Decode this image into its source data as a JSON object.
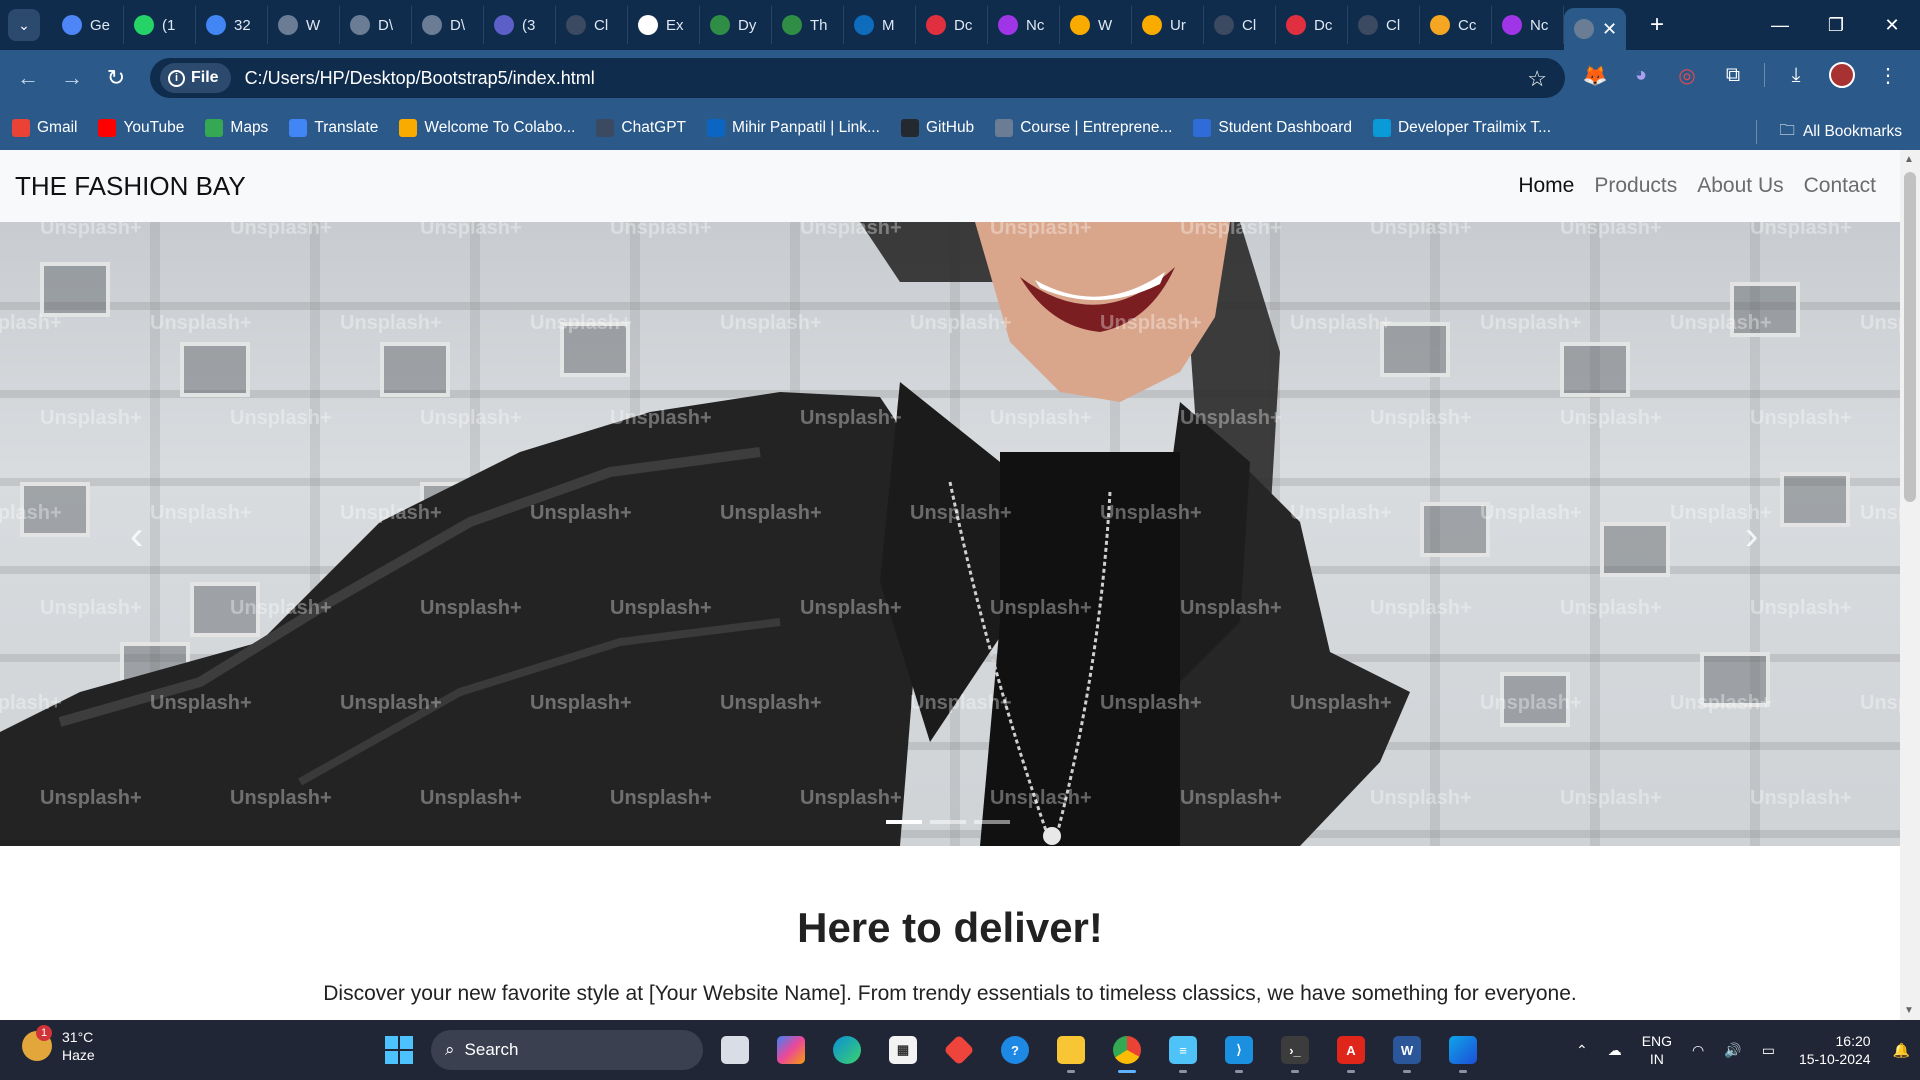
{
  "browser": {
    "tabs": [
      {
        "label": "Ge",
        "icon": "gemini-icon",
        "color": "#4e86f7"
      },
      {
        "label": "(1",
        "icon": "whatsapp-icon",
        "color": "#25d366"
      },
      {
        "label": "32",
        "icon": "docs-icon",
        "color": "#4285f4"
      },
      {
        "label": "W",
        "icon": "globe-icon",
        "color": "#6b7d95"
      },
      {
        "label": "D\\",
        "icon": "globe-icon",
        "color": "#6b7d95"
      },
      {
        "label": "D\\",
        "icon": "globe-icon",
        "color": "#6b7d95"
      },
      {
        "label": "(3",
        "icon": "teams-icon",
        "color": "#5b5fc7"
      },
      {
        "label": "Cl",
        "icon": "chatgpt-icon",
        "color": "#3b4a60"
      },
      {
        "label": "Ex",
        "icon": "google-icon",
        "color": "#ffffff"
      },
      {
        "label": "Dy",
        "icon": "geeks-icon",
        "color": "#2f8d46"
      },
      {
        "label": "Th",
        "icon": "geeks-icon",
        "color": "#2f8d46"
      },
      {
        "label": "M",
        "icon": "outlook-icon",
        "color": "#0f6cbd"
      },
      {
        "label": "Dc",
        "icon": "heart-icon",
        "color": "#e03040"
      },
      {
        "label": "Nc",
        "icon": "messenger-icon",
        "color": "#a035e8"
      },
      {
        "label": "W",
        "icon": "colab-icon",
        "color": "#f9ab00"
      },
      {
        "label": "Ur",
        "icon": "colab-icon",
        "color": "#f9ab00"
      },
      {
        "label": "Cl",
        "icon": "chatgpt-icon",
        "color": "#3b4a60"
      },
      {
        "label": "Dc",
        "icon": "heart-icon",
        "color": "#e03040"
      },
      {
        "label": "Cl",
        "icon": "chatgpt-icon",
        "color": "#3b4a60"
      },
      {
        "label": "Cc",
        "icon": "coursera-icon",
        "color": "#f5a623"
      },
      {
        "label": "Nc",
        "icon": "messenger-icon",
        "color": "#a035e8"
      }
    ],
    "active_tab_icon": "globe-icon",
    "url_chip": "File",
    "url": "C:/Users/HP/Desktop/Bootstrap5/index.html",
    "bookmarks": [
      {
        "label": "Gmail",
        "color": "#ea4335"
      },
      {
        "label": "YouTube",
        "color": "#ff0000"
      },
      {
        "label": "Maps",
        "color": "#34a853"
      },
      {
        "label": "Translate",
        "color": "#4285f4"
      },
      {
        "label": "Welcome To Colabo...",
        "color": "#f9ab00"
      },
      {
        "label": "ChatGPT",
        "color": "#3b4a60"
      },
      {
        "label": "Mihir Panpatil | Link...",
        "color": "#0a66c2"
      },
      {
        "label": "GitHub",
        "color": "#24292f"
      },
      {
        "label": "Course | Entreprene...",
        "color": "#6b7d95"
      },
      {
        "label": "Student Dashboard",
        "color": "#2f6cd8"
      },
      {
        "label": "Developer Trailmix T...",
        "color": "#0b9ad8"
      }
    ],
    "all_bookmarks": "All Bookmarks"
  },
  "site": {
    "brand": "THE FASHION BAY",
    "nav": [
      "Home",
      "Products",
      "About Us",
      "Contact"
    ],
    "active_nav": "Home",
    "watermark": "Unsplash+",
    "headline": "Here to deliver!",
    "lead": "Discover your new favorite style at [Your Website Name]. From trendy essentials to timeless classics, we have something for everyone.",
    "carousel_slides": 3,
    "carousel_active": 1
  },
  "taskbar": {
    "weather_temp": "31°C",
    "weather_desc": "Haze",
    "weather_badge": "1",
    "search": "Search",
    "lang_top": "ENG",
    "lang_bottom": "IN",
    "time": "16:20",
    "date": "15-10-2024"
  }
}
